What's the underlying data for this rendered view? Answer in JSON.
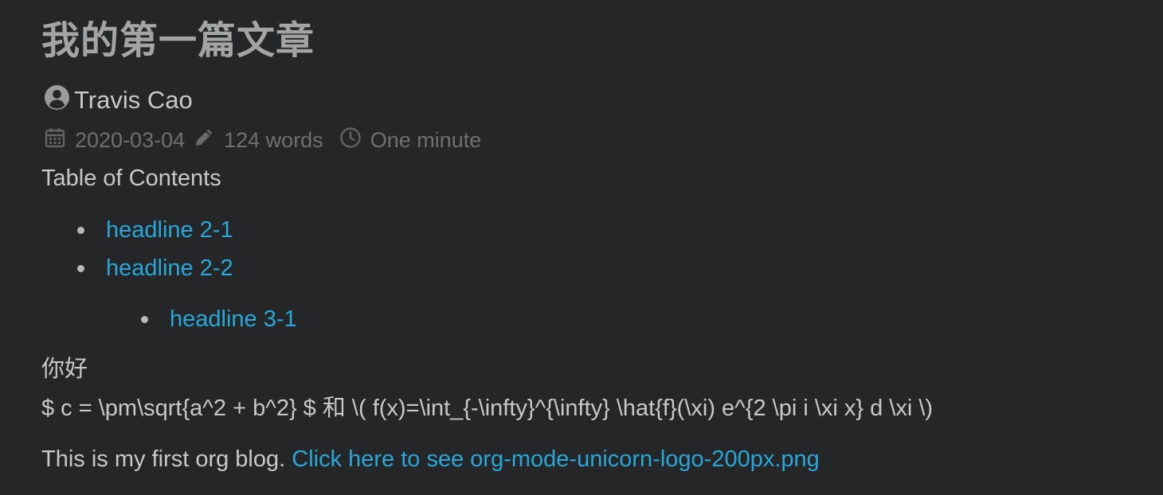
{
  "post": {
    "title": "我的第一篇文章",
    "author": "Travis Cao",
    "date": "2020-03-04",
    "word_count": "124 words",
    "reading_time": "One minute"
  },
  "toc": {
    "title": "Table of Contents",
    "items": [
      {
        "label": "headline 2-1",
        "level": 1
      },
      {
        "label": "headline 2-2",
        "level": 1
      },
      {
        "label": "headline 3-1",
        "level": 2
      }
    ]
  },
  "body": {
    "greeting": "你好",
    "math_line": "$ c = \\pm\\sqrt{a^2 + b^2} $ 和 \\( f(x)=\\int_{-\\infty}^{\\infty} \\hat{f}(\\xi) e^{2 \\pi i \\xi x} d \\xi \\)",
    "intro_text": "This is my first org blog.",
    "link_text": "Click here to see org-mode-unicorn-logo-200px.png"
  },
  "icons": {
    "author": "user-circle-icon",
    "date": "calendar-icon",
    "words": "pencil-icon",
    "time": "clock-icon"
  },
  "colors": {
    "background": "#252628",
    "link": "#29a7d8",
    "title": "#a4a4a4",
    "meta": "#6f6f6f"
  }
}
